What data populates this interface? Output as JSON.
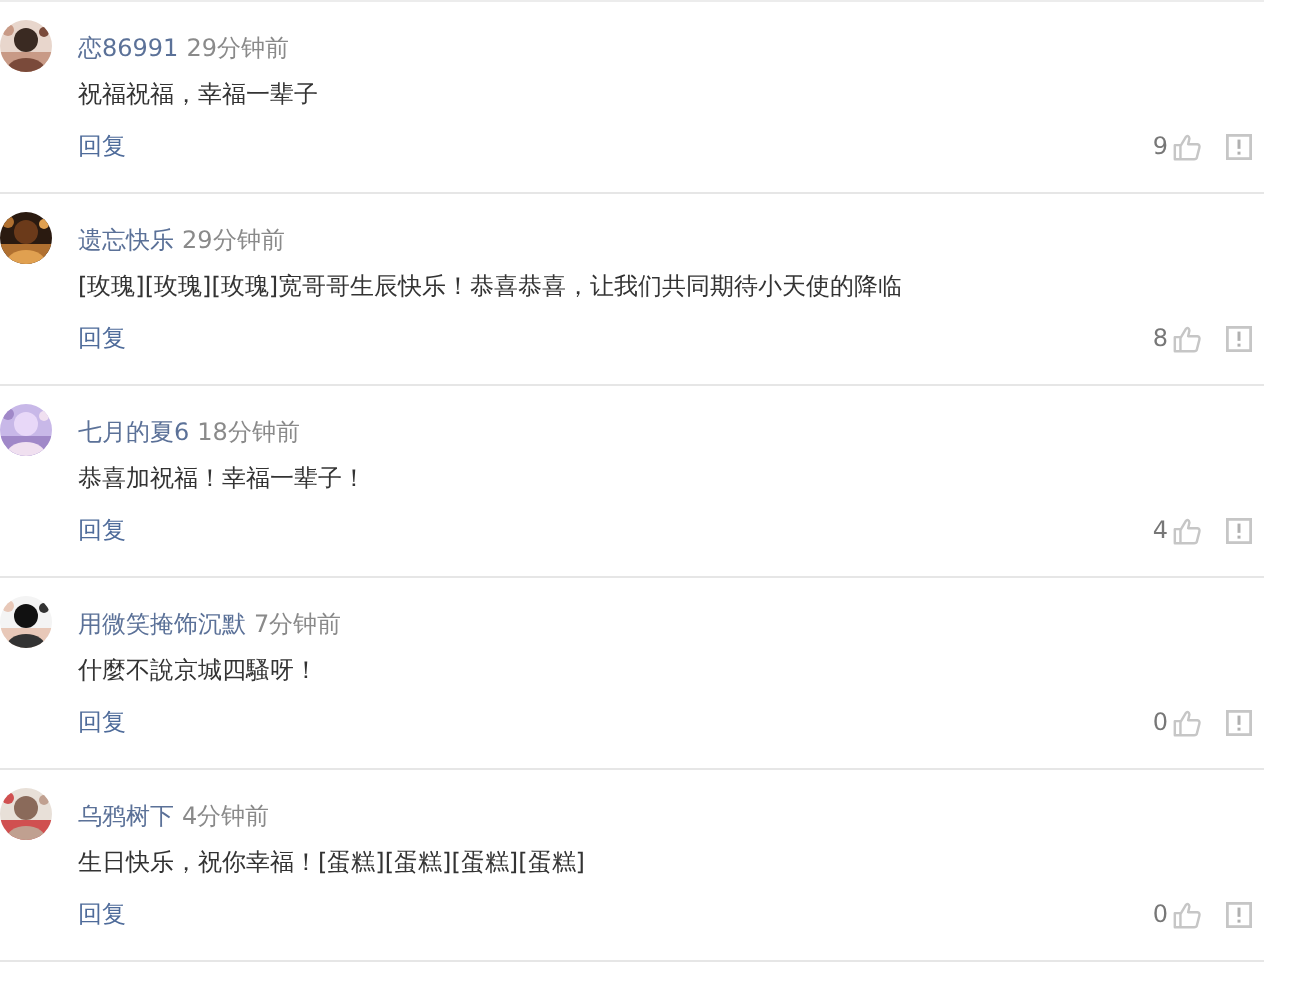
{
  "comments": [
    {
      "user": "恋86991",
      "time": "29分钟前",
      "text": "祝福祝福，幸福一辈子",
      "reply": "回复",
      "likes": "9"
    },
    {
      "user": "遗忘快乐",
      "time": "29分钟前",
      "text": "[玫瑰][玫瑰][玫瑰]宽哥哥生辰快乐！恭喜恭喜，让我们共同期待小天使的降临",
      "reply": "回复",
      "likes": "8"
    },
    {
      "user": "七月的夏6",
      "time": "18分钟前",
      "text": "恭喜加祝福！幸福一辈子！",
      "reply": "回复",
      "likes": "4"
    },
    {
      "user": "用微笑掩饰沉默",
      "time": "7分钟前",
      "text": "什麼不說京城四騷呀！",
      "reply": "回复",
      "likes": "0"
    },
    {
      "user": "乌鸦树下",
      "time": "4分钟前",
      "text": "生日快乐，祝你幸福！[蛋糕][蛋糕][蛋糕][蛋糕]",
      "reply": "回复",
      "likes": "0"
    }
  ]
}
